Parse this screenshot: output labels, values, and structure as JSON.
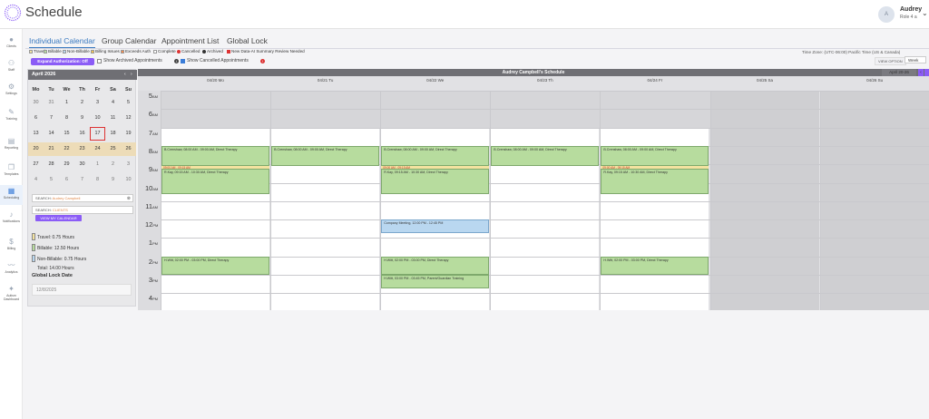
{
  "header": {
    "title": "Schedule",
    "user": {
      "initial": "A",
      "name": "Audrey",
      "role": "Role 4 a"
    }
  },
  "sidebar": [
    {
      "name": "clients",
      "label": "Clients",
      "icon": "person-icon"
    },
    {
      "name": "staff",
      "label": "Staff",
      "icon": "staff-icon"
    },
    {
      "name": "settings",
      "label": "Settings",
      "icon": "gear-icon"
    },
    {
      "name": "training",
      "label": "Training",
      "icon": "training-icon"
    },
    {
      "name": "reporting",
      "label": "Reporting",
      "icon": "report-icon"
    },
    {
      "name": "templates",
      "label": "Templates",
      "icon": "template-icon"
    },
    {
      "name": "scheduling",
      "label": "Scheduling",
      "icon": "calendar-icon"
    },
    {
      "name": "notifications",
      "label": "Notifications",
      "icon": "bell-icon"
    },
    {
      "name": "billing",
      "label": "Billing",
      "icon": "dollar-icon"
    },
    {
      "name": "analytics",
      "label": "Analytics",
      "icon": "chart-icon"
    },
    {
      "name": "autism-dashboard",
      "label": "Autism Dashboard",
      "icon": "figure-icon"
    }
  ],
  "tabs": [
    "Individual Calendar",
    "Group Calendar",
    "Appointment List",
    "Global Lock"
  ],
  "legend": {
    "travel": "Travel",
    "billable": "Billable",
    "non_billable": "Non-Billable",
    "billing_issues": "Billing Issues",
    "exceeds_auth": "Exceeds Auth",
    "complete": "Complete",
    "cancelled": "Cancelled",
    "archived": "Archived",
    "new_data": "New Data-AI Summary Review Needed",
    "colors": {
      "travel": "#f3e3a0",
      "billable": "#b7dc9e",
      "non_billable": "#b9d7f0",
      "billing_issues": "#f2c14e",
      "exceeds_auth": "#f28c50"
    }
  },
  "timezone": "Time Zone: (UTC-06:00) Pacific Time (US & Canada)",
  "controls": {
    "expand_btn": "Expand Authorization: Off",
    "show_archived": "Show Archived Appointments",
    "show_cancelled": "Show Cancelled Appointments",
    "view_option_label": "VIEW OPTION",
    "view_value": "Week"
  },
  "mini_calendar": {
    "month": "April 2026",
    "dow": [
      "Mo",
      "Tu",
      "We",
      "Th",
      "Fr",
      "Sa",
      "Su"
    ],
    "weeks": [
      [
        "30",
        "31",
        "1",
        "2",
        "3",
        "4",
        "5"
      ],
      [
        "6",
        "7",
        "8",
        "9",
        "10",
        "11",
        "12"
      ],
      [
        "13",
        "14",
        "15",
        "16",
        "17",
        "18",
        "19"
      ],
      [
        "20",
        "21",
        "22",
        "23",
        "24",
        "25",
        "26"
      ],
      [
        "27",
        "28",
        "29",
        "30",
        "1",
        "2",
        "3"
      ],
      [
        "4",
        "5",
        "6",
        "7",
        "8",
        "9",
        "10"
      ]
    ],
    "today": "17"
  },
  "search": {
    "staff_label": "SEARCH:",
    "staff_value": "Audrey Campbell",
    "clients_label": "SEARCH:",
    "clients_placeholder": "CLIENTS",
    "my_calendar": "VIEW MY CALENDAR"
  },
  "summary": [
    {
      "label": "Travel: 0.75 Hours",
      "color": "#f3e3a0"
    },
    {
      "label": "Billable: 12.50 Hours",
      "color": "#b7dc9e"
    },
    {
      "label": "Non-Billable: 0.75 Hours",
      "color": "#b9d7f0"
    },
    {
      "label": "Total: 14.00 Hours",
      "color": ""
    }
  ],
  "global_lock": {
    "label": "Global Lock Date",
    "value": "12/8/2025"
  },
  "calendar": {
    "title": "Audrey Campbell's Schedule",
    "week_label": "April 20-26",
    "days": [
      "04/20 Mo",
      "04/21 Tu",
      "04/22 We",
      "04/23 Th",
      "04/24 Fr",
      "04/25 Sa",
      "04/26 Su"
    ],
    "hours": [
      {
        "n": "5",
        "ap": "AM"
      },
      {
        "n": "6",
        "ap": "AM"
      },
      {
        "n": "7",
        "ap": "AM"
      },
      {
        "n": "8",
        "ap": "AM"
      },
      {
        "n": "9",
        "ap": "AM"
      },
      {
        "n": "10",
        "ap": "AM"
      },
      {
        "n": "11",
        "ap": "AM"
      },
      {
        "n": "12",
        "ap": "PM"
      },
      {
        "n": "1",
        "ap": "PM"
      },
      {
        "n": "2",
        "ap": "PM"
      },
      {
        "n": "3",
        "ap": "PM"
      },
      {
        "n": "4",
        "ap": "PM"
      }
    ],
    "events": [
      {
        "day": 0,
        "start": 8,
        "end": 9.1,
        "type": "green",
        "text": "B.Crenshaw, 08:00 AM - 09:00 AM, Direct Therapy"
      },
      {
        "day": 0,
        "start": 9.1,
        "end": 9.22,
        "type": "travel",
        "text": "09:00 AM - 09:15 AM"
      },
      {
        "day": 0,
        "start": 9.25,
        "end": 10.6,
        "type": "green",
        "text": "R.Kay, 09:15 AM - 10:30 AM, Direct Therapy"
      },
      {
        "day": 0,
        "start": 14,
        "end": 15,
        "type": "green",
        "text": "H.Witt, 02:00 PM - 03:00 PM, Direct Therapy"
      },
      {
        "day": 1,
        "start": 8,
        "end": 9.1,
        "type": "green",
        "text": "B.Crenshaw, 08:00 AM - 09:00 AM, Direct Therapy"
      },
      {
        "day": 2,
        "start": 8,
        "end": 9.1,
        "type": "green",
        "text": "B.Crenshaw, 08:00 AM - 09:00 AM, Direct Therapy"
      },
      {
        "day": 2,
        "start": 9.1,
        "end": 9.22,
        "type": "travel",
        "text": "09:00 AM - 09:15 AM"
      },
      {
        "day": 2,
        "start": 9.25,
        "end": 10.6,
        "type": "green",
        "text": "R.Kay, 09:15 AM - 10:30 AM, Direct Therapy"
      },
      {
        "day": 2,
        "start": 12,
        "end": 12.75,
        "type": "blue",
        "text": "Company Meeting, 12:00 PM - 12:45 PM"
      },
      {
        "day": 2,
        "start": 14,
        "end": 15,
        "type": "green",
        "text": "H.Witt, 02:00 PM - 03:00 PM, Direct Therapy"
      },
      {
        "day": 2,
        "start": 15,
        "end": 15.75,
        "type": "green",
        "text": "H.Witt, 03:00 PM - 03:45 PM, Parent/Guardian Training"
      },
      {
        "day": 3,
        "start": 8,
        "end": 9.1,
        "type": "green",
        "text": "B.Crenshaw, 08:00 AM - 09:00 AM, Direct Therapy"
      },
      {
        "day": 4,
        "start": 8,
        "end": 9.1,
        "type": "green",
        "text": "B.Crenshaw, 08:00 AM - 09:00 AM, Direct Therapy"
      },
      {
        "day": 4,
        "start": 9.1,
        "end": 9.22,
        "type": "travel",
        "text": "09:00 AM - 09:15 AM"
      },
      {
        "day": 4,
        "start": 9.25,
        "end": 10.6,
        "type": "green",
        "text": "R.Kay, 09:15 AM - 10:30 AM, Direct Therapy"
      },
      {
        "day": 4,
        "start": 14,
        "end": 15,
        "type": "green",
        "text": "H.Witt, 02:00 PM - 03:00 PM, Direct Therapy"
      }
    ]
  }
}
